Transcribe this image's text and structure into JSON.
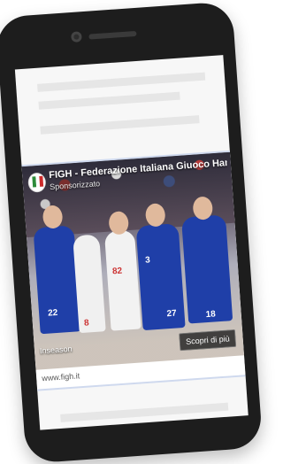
{
  "ad": {
    "advertiser": "FIGH - Federazione Italiana Giuoco Handball",
    "sponsored_label": "Sponsorizzato",
    "cta_label": "Scopri di più",
    "watermark": "Inseason",
    "url": "www.figh.it",
    "jersey_numbers": [
      "22",
      "8",
      "27",
      "18",
      "3",
      "82"
    ]
  },
  "colors": {
    "device_body": "#1d1d1d",
    "italy_blue": "#1f3fa8",
    "screen_bg": "#f7f7f7"
  }
}
